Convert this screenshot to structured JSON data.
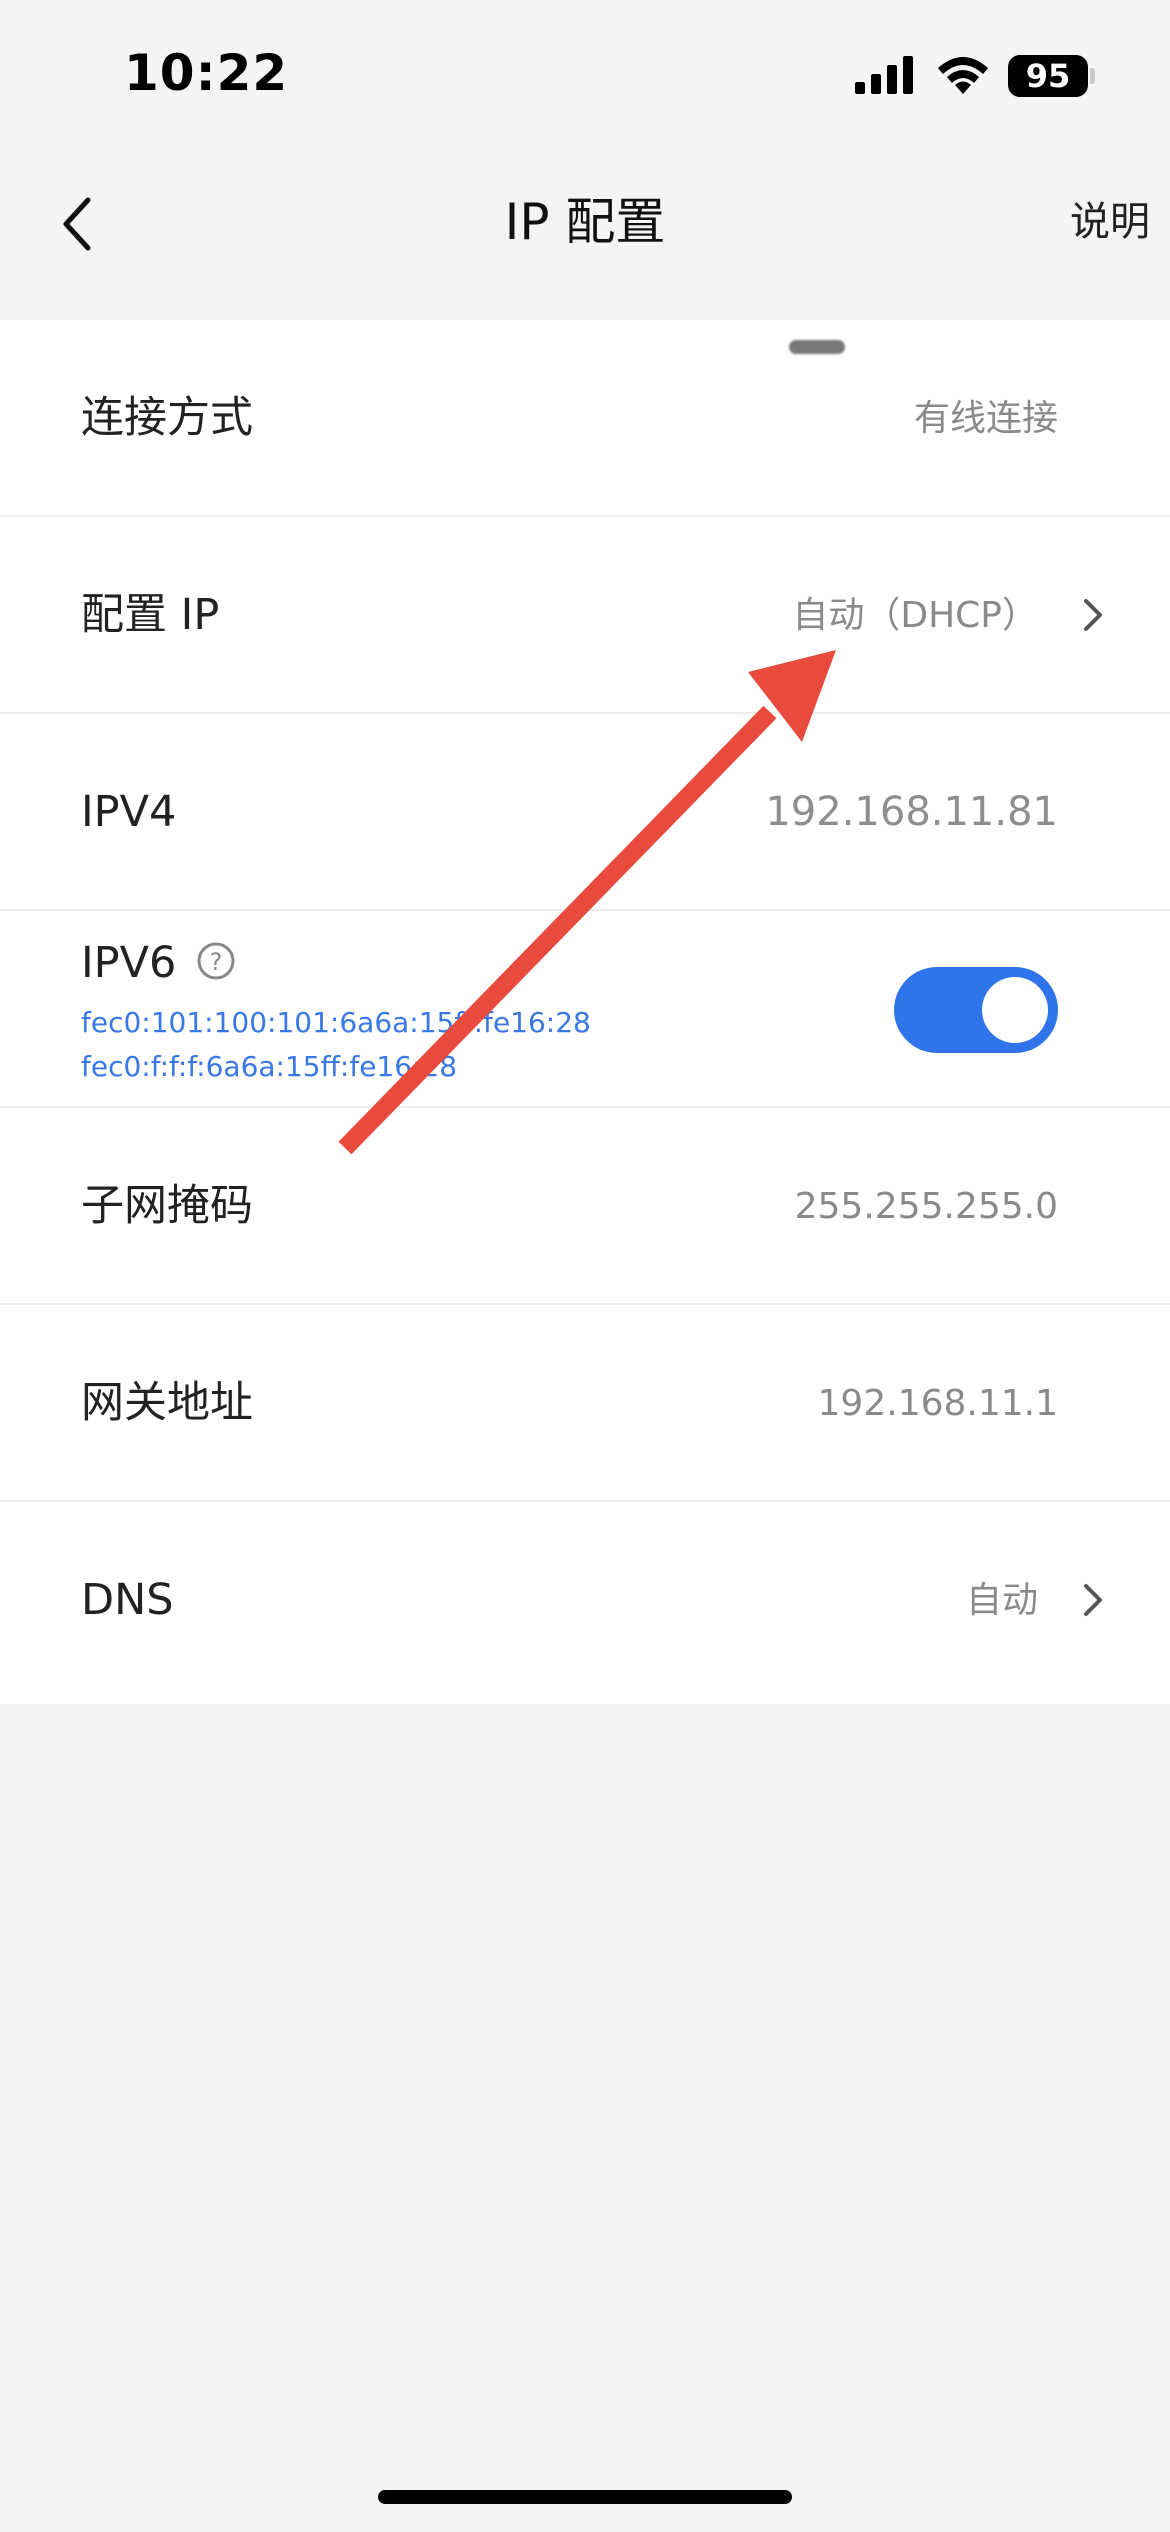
{
  "status_bar": {
    "time": "10:22",
    "battery": "95",
    "icons": [
      "cellular-signal-icon",
      "wifi-icon",
      "battery-icon"
    ]
  },
  "nav": {
    "title": "IP 配置",
    "help": "说明",
    "back_icon": "chevron-left-icon"
  },
  "rows": {
    "connection": {
      "label": "连接方式",
      "value": "有线连接"
    },
    "config_ip": {
      "label": "配置 IP",
      "value": "自动（DHCP）"
    },
    "ipv4": {
      "label": "IPV4",
      "value": "192.168.11.81"
    },
    "ipv6": {
      "label": "IPV6",
      "addresses": [
        "fec0:101:100:101:6a6a:15ff:fe16:28",
        "fec0:f:f:f:6a6a:15ff:fe16:28"
      ],
      "enabled": true
    },
    "subnet": {
      "label": "子网掩码",
      "value": "255.255.255.0"
    },
    "gateway": {
      "label": "网关地址",
      "value": "192.168.11.1"
    },
    "dns": {
      "label": "DNS",
      "value": "自动"
    }
  },
  "colors": {
    "accent": "#2f74ea",
    "link_text": "#3a78e6",
    "annotation_arrow": "#e84a3e",
    "background": "#f3f4f6"
  }
}
